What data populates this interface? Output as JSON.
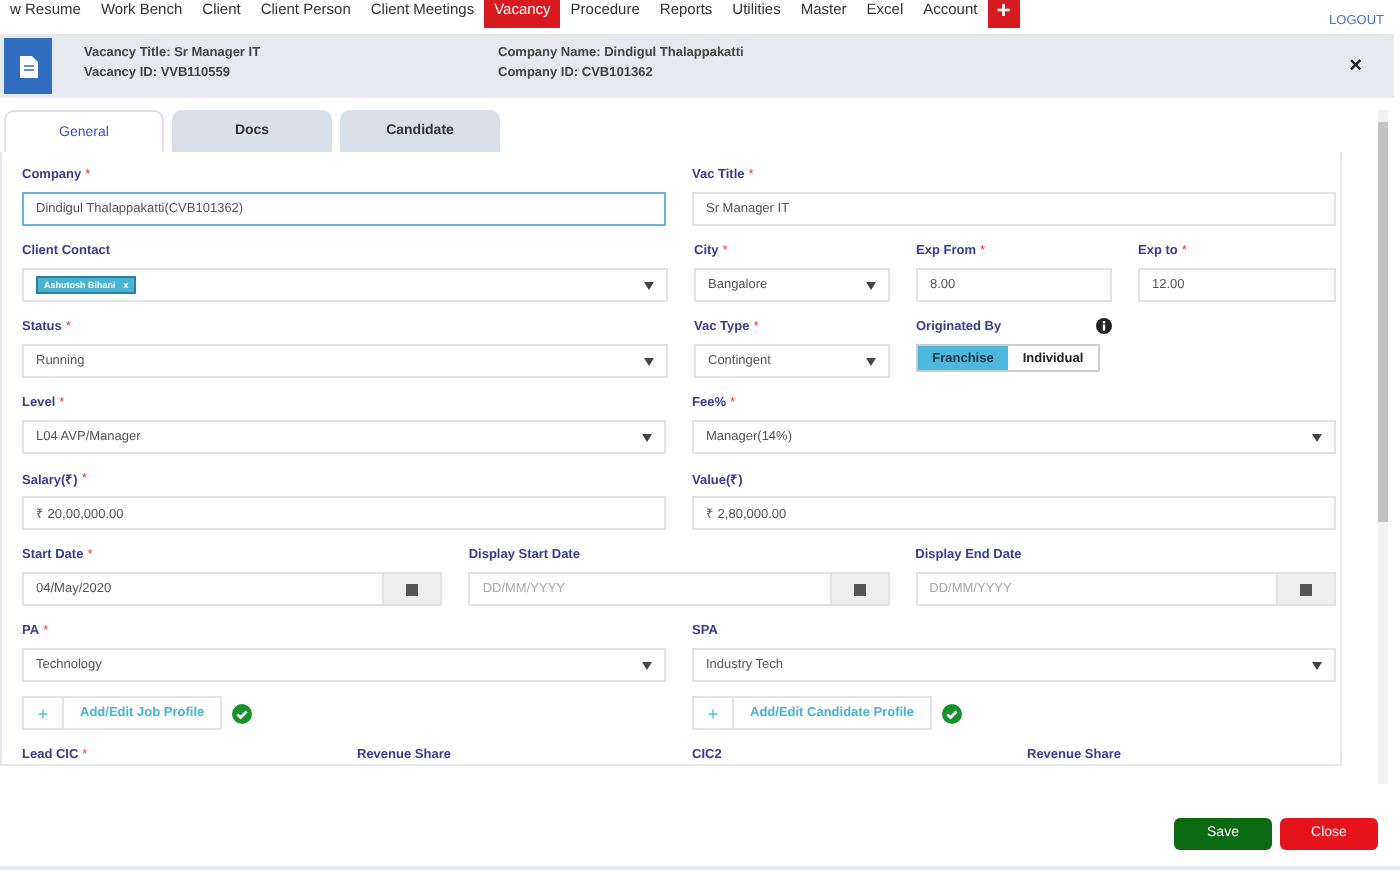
{
  "nav": {
    "items": [
      {
        "label": "w Resume",
        "selected": false
      },
      {
        "label": "Work Bench",
        "selected": false
      },
      {
        "label": "Client",
        "selected": false
      },
      {
        "label": "Client Person",
        "selected": false
      },
      {
        "label": "Client Meetings",
        "selected": false
      },
      {
        "label": "Vacancy",
        "selected": true
      },
      {
        "label": "Procedure",
        "selected": false
      },
      {
        "label": "Reports",
        "selected": false
      },
      {
        "label": "Utilities",
        "selected": false
      },
      {
        "label": "Master",
        "selected": false
      },
      {
        "label": "Excel",
        "selected": false
      },
      {
        "label": "Account",
        "selected": false
      }
    ],
    "add": "+",
    "logout": "LOGOUT"
  },
  "header": {
    "fields": [
      {
        "label": "Vacancy Title:",
        "value": "Sr Manager IT"
      },
      {
        "label": "Vacancy ID:",
        "value": "VVB110559"
      },
      {
        "label": "Company Name:",
        "value": "Dindigul Thalappakatti"
      },
      {
        "label": "Company ID:",
        "value": "CVB101362"
      }
    ],
    "close": "×"
  },
  "tabs": [
    {
      "label": "General",
      "selected": true
    },
    {
      "label": "Docs",
      "selected": false
    },
    {
      "label": "Candidate",
      "selected": false
    }
  ],
  "rows": [
    {
      "fields": [
        {
          "kind": "input",
          "label": "Company",
          "required_mark": "*",
          "value": "Dindigul Thalappakatti(CVB101362)",
          "focused": true
        },
        {
          "kind": "input",
          "label": "Vac Title",
          "required_mark": "*",
          "value": "Sr Manager IT",
          "focused": false
        }
      ]
    },
    {
      "fields": [
        {
          "kind": "tags",
          "label": "Client Contact",
          "tags": [
            {
              "label": "Ashutosh Bihani",
              "remove": "x"
            }
          ]
        },
        {
          "kind": "select",
          "label": "City",
          "required_mark": "*",
          "value": "Bangalore"
        },
        {
          "kind": "input",
          "label": "Exp From",
          "required_mark": "*",
          "value": "8.00",
          "focused": false
        },
        {
          "kind": "input",
          "label": "Exp to",
          "required_mark": "*",
          "value": "12.00",
          "focused": false
        }
      ]
    },
    {
      "fields": [
        {
          "kind": "select",
          "label": "Status",
          "required_mark": "*",
          "value": "Running"
        },
        {
          "kind": "select",
          "label": "Vac Type",
          "required_mark": "*",
          "value": "Contingent"
        },
        {
          "kind": "toggle",
          "label": "Originated By",
          "options": [
            {
              "label": "Franchise",
              "selected": true
            },
            {
              "label": "Individual",
              "selected": false
            }
          ]
        }
      ]
    },
    {
      "fields": [
        {
          "kind": "select",
          "label": "Level",
          "required_mark": "*",
          "value": "L04 AVP/Manager"
        },
        {
          "kind": "select",
          "label": "Fee%",
          "required_mark": "*",
          "value": "Manager(14%)"
        }
      ]
    },
    {
      "fields": [
        {
          "kind": "input",
          "label": "Salary(₹)",
          "required_mark": "*",
          "value": "₹ 20,00,000.00",
          "focused": false
        },
        {
          "kind": "input",
          "label": "Value(₹)",
          "value": "₹ 2,80,000.00",
          "focused": false
        }
      ]
    },
    {
      "fields": [
        {
          "kind": "date",
          "label": "Start Date",
          "required_mark": "*",
          "value": "04/May/2020"
        },
        {
          "kind": "date",
          "label": "Display Start Date",
          "placeholder": "DD/MM/YYYY"
        },
        {
          "kind": "date",
          "label": "Display End Date",
          "placeholder": "DD/MM/YYYY"
        }
      ]
    },
    {
      "fields": [
        {
          "kind": "select",
          "label": "PA",
          "required_mark": "*",
          "value": "Technology"
        },
        {
          "kind": "select",
          "label": "SPA",
          "value": "Industry Tech"
        }
      ]
    },
    {
      "fields": [
        {
          "kind": "profile",
          "plus": "+",
          "label": "Add/Edit Job Profile",
          "done": true
        },
        {
          "kind": "profile",
          "plus": "+",
          "label": "Add/Edit Candidate Profile",
          "done": true
        }
      ]
    },
    {
      "fields": [
        {
          "kind": "label",
          "label": "Lead CIC",
          "required_mark": "*"
        },
        {
          "kind": "label",
          "label": "Revenue Share"
        },
        {
          "kind": "label",
          "label": "CIC2"
        },
        {
          "kind": "label",
          "label": "Revenue Share"
        }
      ]
    }
  ],
  "footer": {
    "buttons": [
      {
        "kind": "save",
        "label": "Save"
      },
      {
        "kind": "close",
        "label": "Close"
      }
    ]
  }
}
